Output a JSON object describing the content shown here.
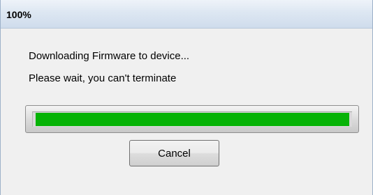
{
  "window": {
    "title": "100%"
  },
  "dialog": {
    "message_line1": "Downloading Firmware to device...",
    "message_line2": "Please wait, you can't terminate"
  },
  "progress": {
    "value_fraction": 1.0,
    "fill_color": "#06b306"
  },
  "buttons": {
    "cancel_label": "Cancel"
  }
}
